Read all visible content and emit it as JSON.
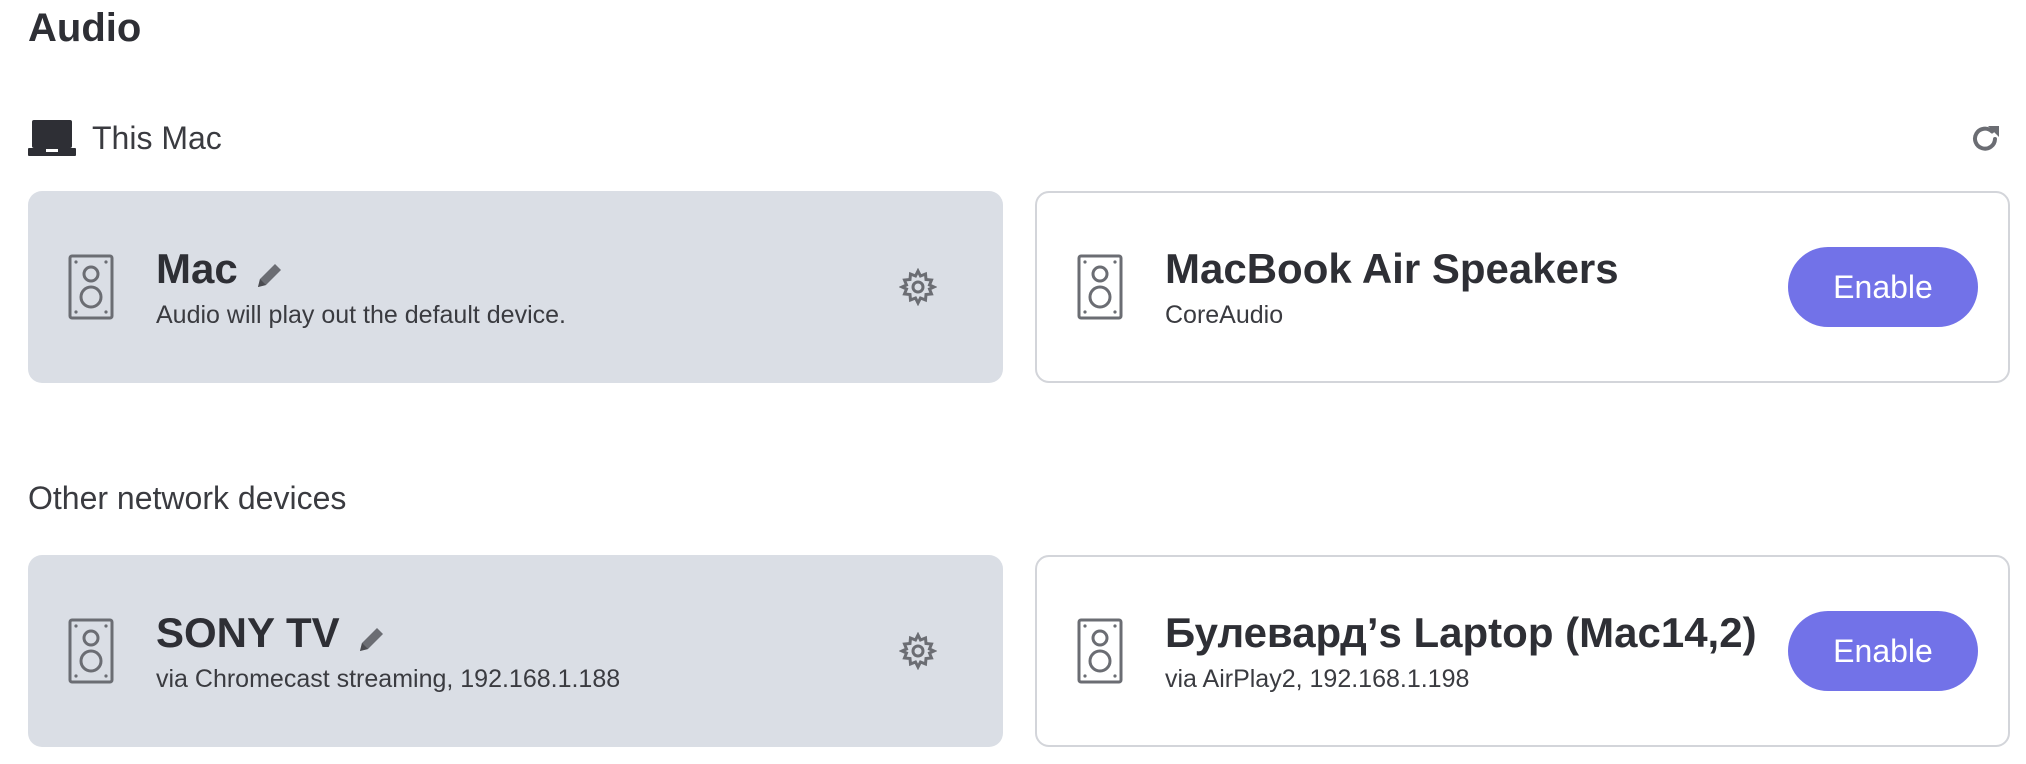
{
  "page": {
    "title": "Audio"
  },
  "this_mac": {
    "heading": "This Mac",
    "icon": "laptop-icon",
    "refresh_icon": "refresh-icon",
    "active_device": {
      "name": "Mac",
      "description": "Audio will play out the default device.",
      "icon": "speaker-icon"
    },
    "available_device": {
      "name": "MacBook Air Speakers",
      "description": "CoreAudio",
      "button_label": "Enable",
      "icon": "speaker-icon"
    }
  },
  "network": {
    "heading": "Other network devices",
    "active_device": {
      "name": "SONY TV",
      "description": "via Chromecast streaming, 192.168.1.188",
      "icon": "speaker-icon"
    },
    "available_device": {
      "name": "Булевард’s Laptop (Mac14,2)",
      "description": "via AirPlay2, 192.168.1.198",
      "button_label": "Enable",
      "icon": "speaker-icon"
    }
  },
  "colors": {
    "accent": "#7272e8",
    "active_card_bg": "#dadee5",
    "card_border": "#d3d5da",
    "icon_gray": "#6b6d73"
  }
}
